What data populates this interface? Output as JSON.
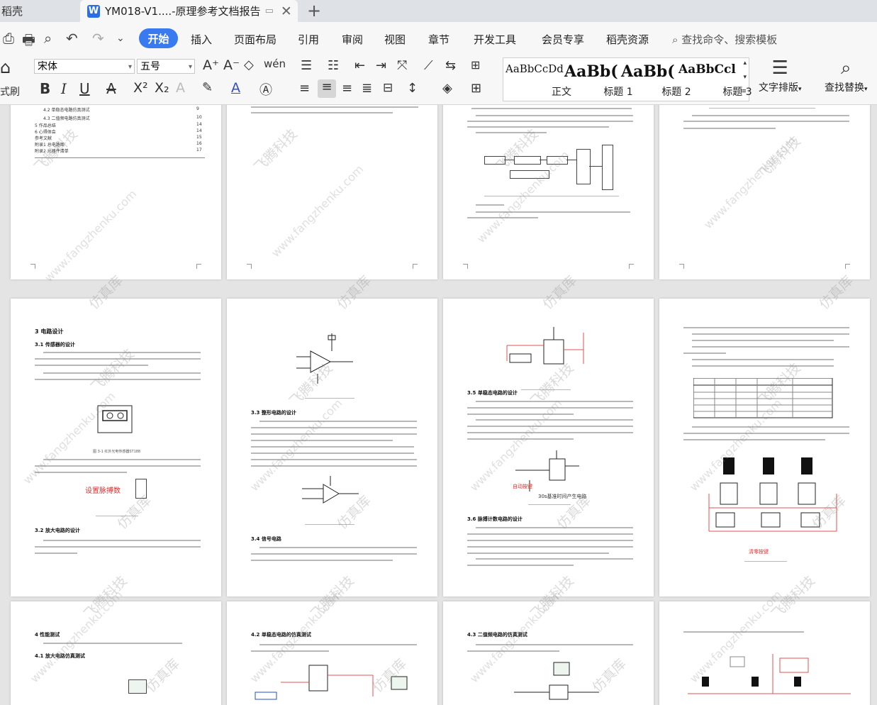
{
  "tabs": [
    {
      "label": "稻壳"
    },
    {
      "label": "YM018-V1....-原理参考文档报告"
    }
  ],
  "menu": {
    "items": [
      "开始",
      "插入",
      "页面布局",
      "引用",
      "审阅",
      "视图",
      "章节",
      "开发工具",
      "会员专享",
      "稻壳资源"
    ],
    "search": "查找命令、搜索模板"
  },
  "ribbon": {
    "format_painter": "式刷",
    "font": "宋体",
    "size": "五号",
    "styles": [
      {
        "sample": "AaBbCcDd",
        "name": "正文"
      },
      {
        "sample": "AaBb(",
        "name": "标题 1"
      },
      {
        "sample": "AaBb(",
        "name": "标题 2"
      },
      {
        "sample": "AaBbCcl",
        "name": "标题 3"
      }
    ],
    "text_layout": "文字排版",
    "find_replace": "查找替换"
  },
  "doc": {
    "p1": {
      "toc": [
        "4.2 单稳态电路仿真测试",
        "4.3 二值频电路仿真测试",
        "5 作品总结",
        "6 心得体会",
        "参考文献",
        "附录1 总电路图",
        "附录2 元器件清单"
      ],
      "toc_pages": [
        "9",
        "10",
        "14",
        "14",
        "15",
        "16",
        "17"
      ]
    },
    "p5": {
      "h_design": "3 电路设计",
      "h_sensor": "3.1 传感器的设计",
      "cap_fig1": "图 3-1 红外光电传感器ST188",
      "red_label": "设置脉搏数",
      "h_amp": "3.2 放大电路的设计"
    },
    "p6": {
      "h_shaping": "3.3 整形电路的设计",
      "h_signal": "3.4 信号电路"
    },
    "p7": {
      "h_mono": "3.5 单稳态电路的设计",
      "auto_btn": "自动按键",
      "circuit_caption": "30s基准时间产生电路",
      "h_pulse": "3.6 脉搏计数电路的设计"
    },
    "p8": {
      "clear_btn": "清零按键"
    },
    "p9": {
      "h_perf": "4 性能测试",
      "h_amp_sim": "4.1 放大电路仿真测试"
    },
    "p10": {
      "h_mono_sim": "4.2 单稳态电路的仿真测试"
    },
    "p11": {
      "h_freq_sim": "4.3 二值频电路的仿真测试"
    }
  },
  "watermark": {
    "cn": "飞腾科技",
    "mid": "仿真库",
    "url": "www.fangzhenku.com"
  }
}
